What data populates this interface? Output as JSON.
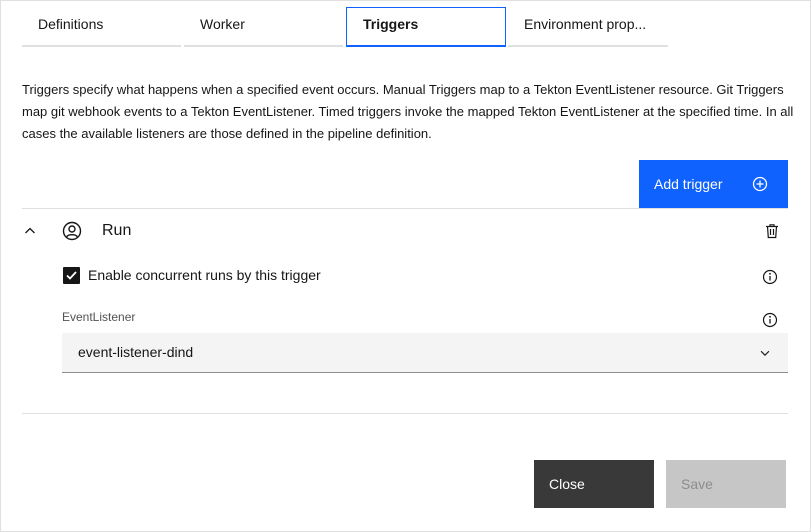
{
  "tabs": [
    {
      "label": "Definitions"
    },
    {
      "label": "Worker"
    },
    {
      "label": "Triggers"
    },
    {
      "label": "Environment prop..."
    }
  ],
  "description": "Triggers specify what happens when a specified event occurs. Manual Triggers map to a Tekton EventListener resource. Git Triggers map git webhook events to a Tekton EventListener. Timed triggers invoke the mapped Tekton EventListener at the specified time. In all cases the available listeners are those defined in the pipeline definition.",
  "add_trigger_label": "Add trigger",
  "trigger": {
    "name": "Run",
    "concurrent_label": "Enable concurrent runs by this trigger",
    "concurrent_checked": true,
    "listener_label": "EventListener",
    "listener_value": "event-listener-dind"
  },
  "footer": {
    "close_label": "Close",
    "save_label": "Save"
  },
  "icons": {
    "collapse": "chevron-up-icon",
    "user": "user-avatar-icon",
    "delete": "trash-icon",
    "info": "info-icon",
    "add": "add-circle-icon",
    "dropdown": "chevron-down-icon"
  },
  "colors": {
    "primary": "#0f62fe",
    "secondary": "#393939",
    "disabled": "#c6c6c6"
  }
}
